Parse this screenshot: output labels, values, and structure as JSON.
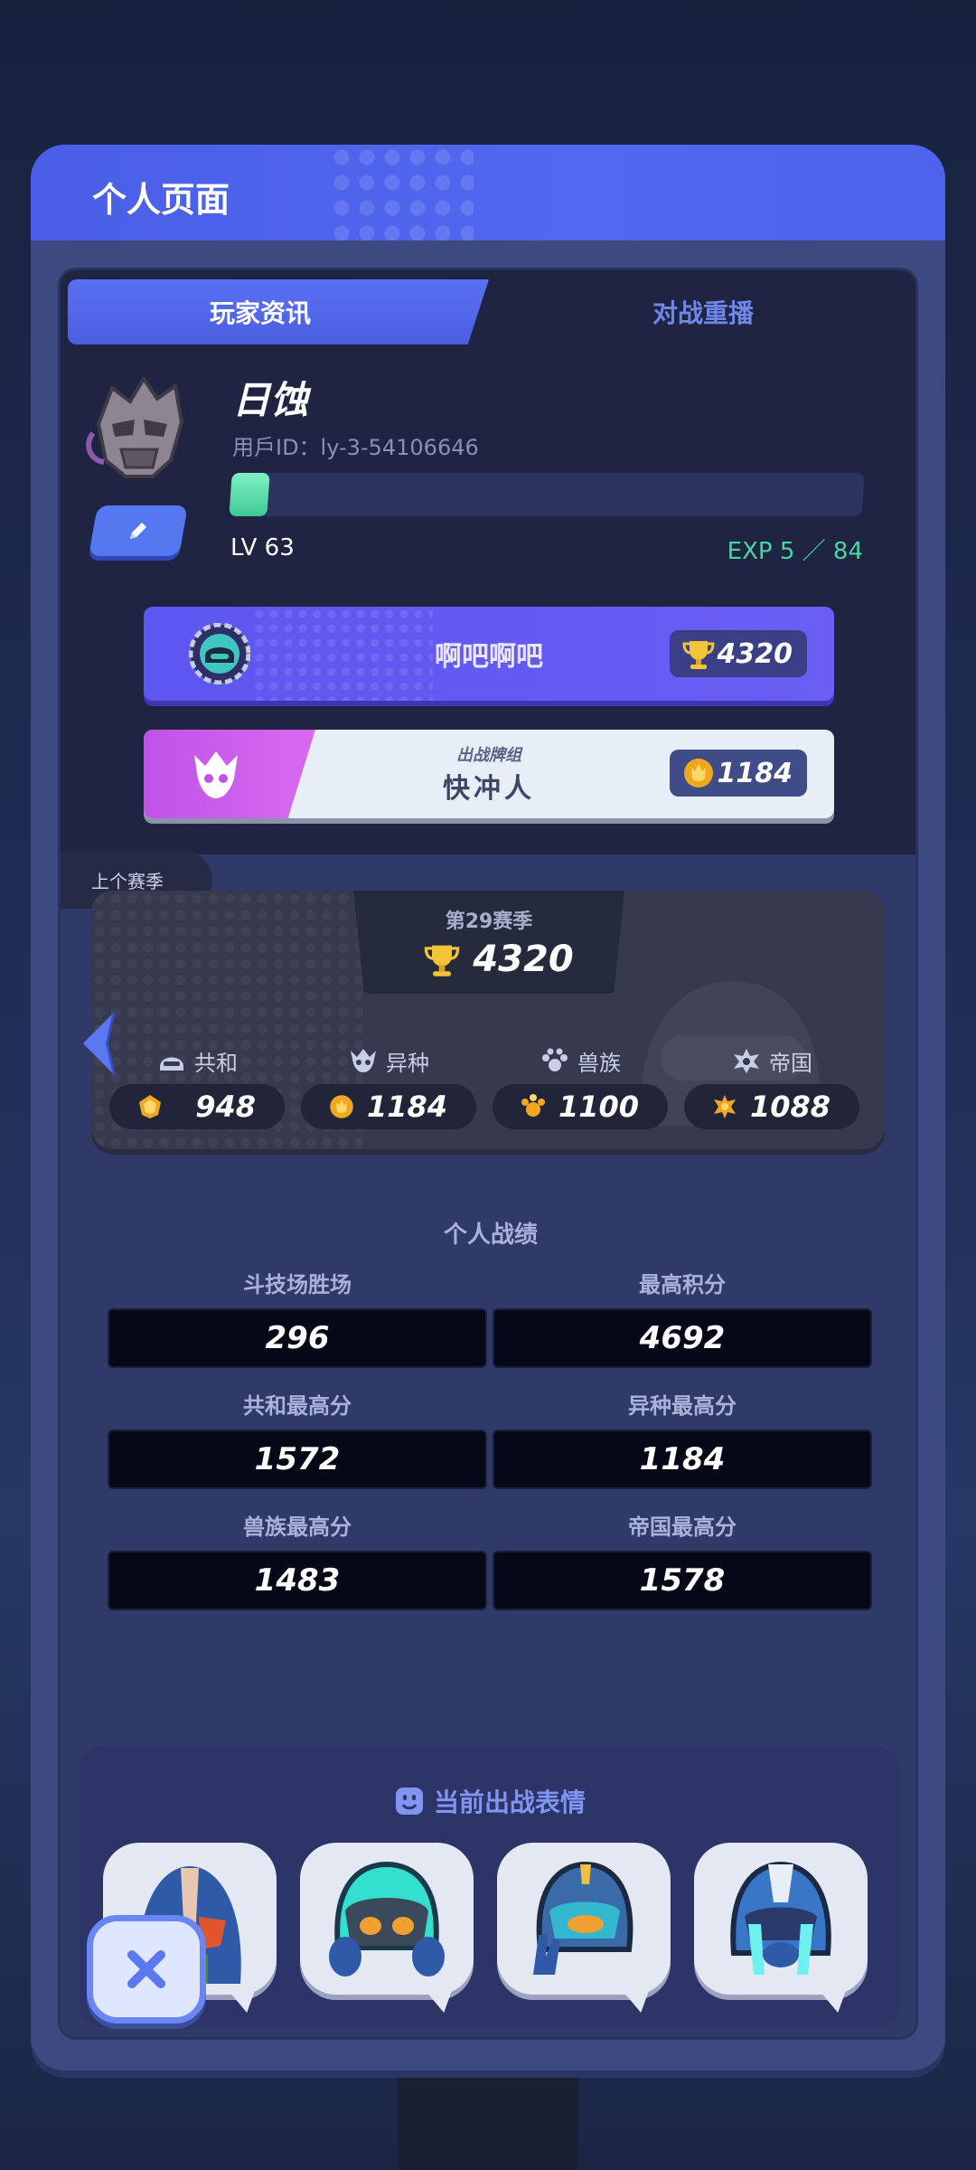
{
  "page": {
    "title": "个人页面"
  },
  "tabs": [
    {
      "label": "玩家资讯",
      "active": true
    },
    {
      "label": "对战重播",
      "active": false
    }
  ],
  "player": {
    "name": "日蚀",
    "user_id": "用戶ID：ly-3-54106646",
    "level": "LV 63",
    "exp_text": "EXP 5 ／ 84",
    "exp_fraction": 0.06
  },
  "guild": {
    "name": "啊吧啊吧",
    "trophies": "4320"
  },
  "deck": {
    "subtitle": "出战牌组",
    "name": "快冲人",
    "score": "1184"
  },
  "season": {
    "tag": "上个赛季",
    "label": "第29赛季",
    "trophies": "4320",
    "factions": [
      {
        "name": "共和",
        "value": "948",
        "icon": "republic-icon"
      },
      {
        "name": "异种",
        "value": "1184",
        "icon": "xeno-icon"
      },
      {
        "name": "兽族",
        "value": "1100",
        "icon": "beast-icon"
      },
      {
        "name": "帝国",
        "value": "1088",
        "icon": "empire-icon"
      }
    ]
  },
  "stats": {
    "title": "个人战绩",
    "items": [
      {
        "label": "斗技场胜场",
        "value": "296"
      },
      {
        "label": "最高积分",
        "value": "4692"
      },
      {
        "label": "共和最高分",
        "value": "1572"
      },
      {
        "label": "异种最高分",
        "value": "1184"
      },
      {
        "label": "兽族最高分",
        "value": "1483"
      },
      {
        "label": "帝国最高分",
        "value": "1578"
      }
    ]
  },
  "emotes": {
    "title": "当前出战表情",
    "items": [
      "emote-1",
      "emote-2",
      "emote-3",
      "emote-4"
    ]
  },
  "colors": {
    "header": "#4a5ee8",
    "exp": "#48d6a0",
    "guild": "#5d56f0",
    "deck": "#c052e8"
  }
}
